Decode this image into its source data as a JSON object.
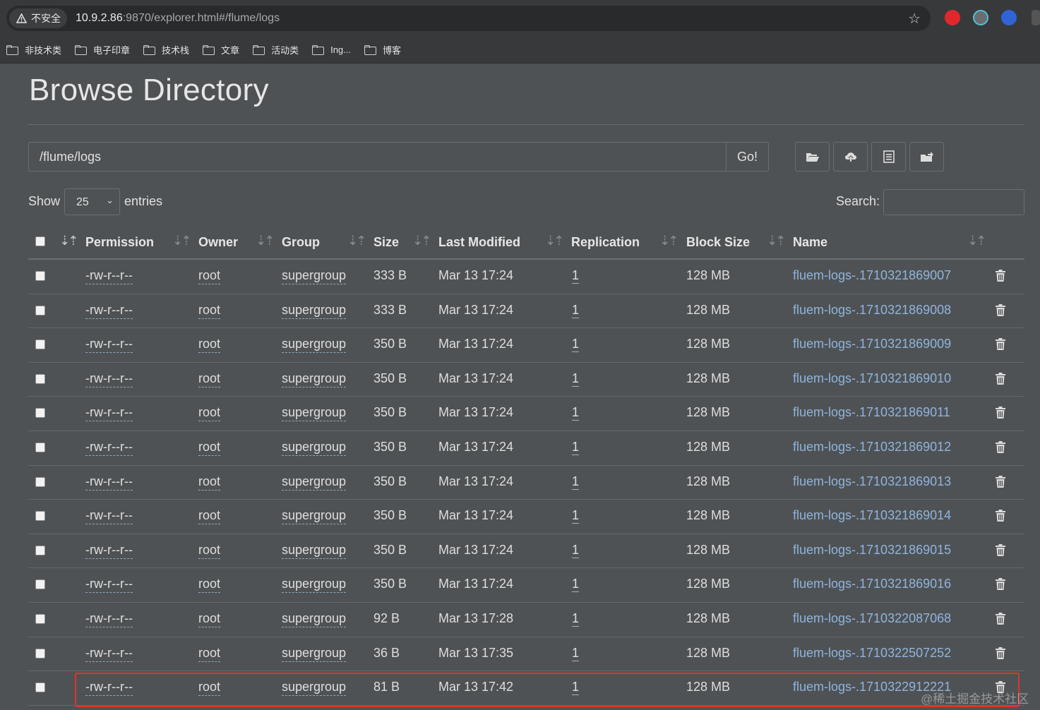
{
  "browser": {
    "security_label": "不安全",
    "url_host": "10.9.2.86",
    "url_rest": ":9870/explorer.html#/flume/logs",
    "bookmarks": [
      "非技术类",
      "电子印章",
      "技术栈",
      "文章",
      "活动类",
      "Ing...",
      "博客"
    ]
  },
  "page": {
    "title": "Browse Directory",
    "path_value": "/flume/logs",
    "go_label": "Go!",
    "show_label": "Show",
    "entries_value": "25",
    "entries_label": "entries",
    "search_label": "Search:",
    "search_value": ""
  },
  "table": {
    "columns": [
      "Permission",
      "Owner",
      "Group",
      "Size",
      "Last Modified",
      "Replication",
      "Block Size",
      "Name"
    ],
    "rows": [
      {
        "permission": "-rw-r--r--",
        "owner": "root",
        "group": "supergroup",
        "size": "333 B",
        "modified": "Mar 13 17:24",
        "replication": "1",
        "block_size": "128 MB",
        "name": "fluem-logs-.1710321869007"
      },
      {
        "permission": "-rw-r--r--",
        "owner": "root",
        "group": "supergroup",
        "size": "333 B",
        "modified": "Mar 13 17:24",
        "replication": "1",
        "block_size": "128 MB",
        "name": "fluem-logs-.1710321869008"
      },
      {
        "permission": "-rw-r--r--",
        "owner": "root",
        "group": "supergroup",
        "size": "350 B",
        "modified": "Mar 13 17:24",
        "replication": "1",
        "block_size": "128 MB",
        "name": "fluem-logs-.1710321869009"
      },
      {
        "permission": "-rw-r--r--",
        "owner": "root",
        "group": "supergroup",
        "size": "350 B",
        "modified": "Mar 13 17:24",
        "replication": "1",
        "block_size": "128 MB",
        "name": "fluem-logs-.1710321869010"
      },
      {
        "permission": "-rw-r--r--",
        "owner": "root",
        "group": "supergroup",
        "size": "350 B",
        "modified": "Mar 13 17:24",
        "replication": "1",
        "block_size": "128 MB",
        "name": "fluem-logs-.1710321869011"
      },
      {
        "permission": "-rw-r--r--",
        "owner": "root",
        "group": "supergroup",
        "size": "350 B",
        "modified": "Mar 13 17:24",
        "replication": "1",
        "block_size": "128 MB",
        "name": "fluem-logs-.1710321869012"
      },
      {
        "permission": "-rw-r--r--",
        "owner": "root",
        "group": "supergroup",
        "size": "350 B",
        "modified": "Mar 13 17:24",
        "replication": "1",
        "block_size": "128 MB",
        "name": "fluem-logs-.1710321869013"
      },
      {
        "permission": "-rw-r--r--",
        "owner": "root",
        "group": "supergroup",
        "size": "350 B",
        "modified": "Mar 13 17:24",
        "replication": "1",
        "block_size": "128 MB",
        "name": "fluem-logs-.1710321869014"
      },
      {
        "permission": "-rw-r--r--",
        "owner": "root",
        "group": "supergroup",
        "size": "350 B",
        "modified": "Mar 13 17:24",
        "replication": "1",
        "block_size": "128 MB",
        "name": "fluem-logs-.1710321869015"
      },
      {
        "permission": "-rw-r--r--",
        "owner": "root",
        "group": "supergroup",
        "size": "350 B",
        "modified": "Mar 13 17:24",
        "replication": "1",
        "block_size": "128 MB",
        "name": "fluem-logs-.1710321869016"
      },
      {
        "permission": "-rw-r--r--",
        "owner": "root",
        "group": "supergroup",
        "size": "92 B",
        "modified": "Mar 13 17:28",
        "replication": "1",
        "block_size": "128 MB",
        "name": "fluem-logs-.1710322087068"
      },
      {
        "permission": "-rw-r--r--",
        "owner": "root",
        "group": "supergroup",
        "size": "36 B",
        "modified": "Mar 13 17:35",
        "replication": "1",
        "block_size": "128 MB",
        "name": "fluem-logs-.1710322507252"
      },
      {
        "permission": "-rw-r--r--",
        "owner": "root",
        "group": "supergroup",
        "size": "81 B",
        "modified": "Mar 13 17:42",
        "replication": "1",
        "block_size": "128 MB",
        "name": "fluem-logs-.1710322912221"
      }
    ]
  },
  "watermark": "@稀土掘金技术社区",
  "colors": {
    "page_bg": "#4f5254",
    "link": "#8fb4de",
    "highlight": "#e2322f"
  }
}
